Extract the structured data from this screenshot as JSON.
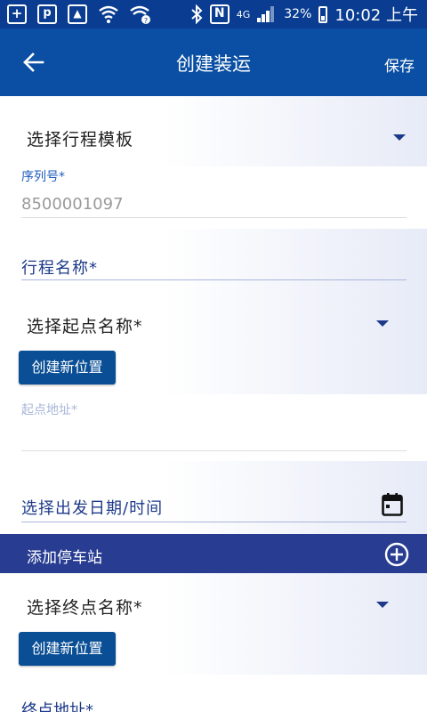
{
  "status_bar": {
    "battery_percent": "32%",
    "time": "10:02 上午",
    "network": "4G",
    "left_icons": [
      "plus-box-icon",
      "message-icon",
      "image-icon",
      "wifi-icon",
      "wifi-question-icon"
    ],
    "right_icons": [
      "bluetooth-icon",
      "nfc-icon",
      "network-4g-icon",
      "signal-icon",
      "battery-icon"
    ]
  },
  "toolbar": {
    "title": "创建装运",
    "save_label": "保存",
    "back_icon": "arrow-left-icon"
  },
  "form": {
    "trip_template_label": "选择行程模板",
    "serial_label": "序列号*",
    "serial_value": "8500001097",
    "trip_name_label": "行程名称*",
    "start_name_label": "选择起点名称*",
    "create_location_label": "创建新位置",
    "start_address_label": "起点地址*",
    "departure_label": "选择出发日期/时间",
    "add_stop_label": "添加停车站",
    "end_name_label": "选择终点名称*",
    "create_location_label_2": "创建新位置",
    "end_address_label": "终点地址*"
  },
  "colors": {
    "status_bar": "#0a3d91",
    "toolbar": "#0a4fa3",
    "accent": "#1d3a8a",
    "stop_bar": "#283d92",
    "button": "#0a4f95"
  }
}
